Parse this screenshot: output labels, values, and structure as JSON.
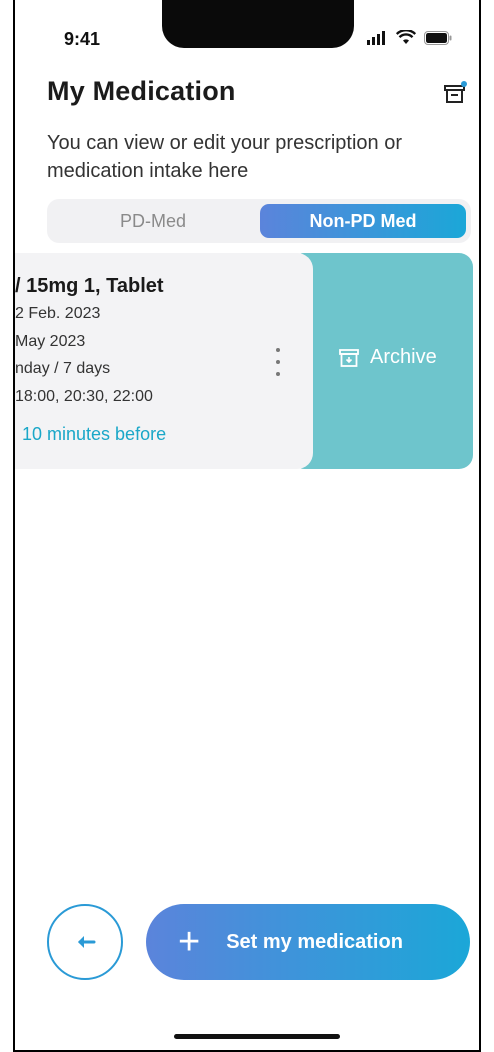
{
  "status_bar": {
    "time": "9:41"
  },
  "header": {
    "title": "My Medication",
    "subtitle": "You can view or edit your prescription or medication intake here"
  },
  "tabs": {
    "items": [
      {
        "label": "PD-Med",
        "active": false
      },
      {
        "label": "Non-PD Med",
        "active": true
      }
    ]
  },
  "medication_card": {
    "title": "/ 15mg 1, Tablet",
    "start": "2 Feb. 2023",
    "end": " May 2023",
    "frequency": "nday / 7 days",
    "times": "18:00, 20:30, 22:00",
    "reminder": "10 minutes before",
    "archive_label": "Archive"
  },
  "actions": {
    "set_medication_label": "Set my medication"
  },
  "colors": {
    "accent_gradient_start": "#5b84db",
    "accent_gradient_end": "#1ba7d8",
    "archive_panel": "#6ec5cc",
    "reminder_text": "#1aa7c8"
  },
  "icons": {
    "archive": "archive-icon",
    "back": "arrow-left-icon",
    "add": "plus-icon",
    "more": "more-vertical-icon"
  }
}
